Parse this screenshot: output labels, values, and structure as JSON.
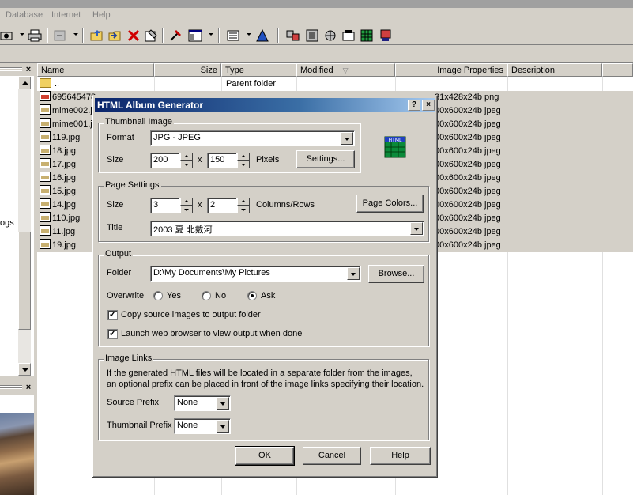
{
  "menu": {
    "database": "Database",
    "internet": "Internet",
    "help": "Help"
  },
  "icons": [
    "connect-icon",
    "printer-icon",
    "reload-icon",
    "copy-to-icon",
    "move-to-icon",
    "delete-icon",
    "properties-icon",
    "tools-icon",
    "view-icon",
    "details-view-icon",
    "filter-icon",
    "slideshow-icon",
    "edit-icon",
    "wallpaper-icon",
    "email-icon",
    "grid-icon",
    "html-icon"
  ],
  "tree": {
    "visible_text": "ogs"
  },
  "file_list": {
    "columns": {
      "name": "Name",
      "size": "Size",
      "type": "Type",
      "modified": "Modified",
      "image_properties": "Image Properties",
      "description": "Description"
    },
    "parent": {
      "name": "..",
      "type": "Parent folder"
    },
    "rows": [
      {
        "name": "695645478",
        "props": "31x428x24b png",
        "kind": "png"
      },
      {
        "name": "mime002.jp",
        "props": "00x600x24b jpeg",
        "kind": "jpg"
      },
      {
        "name": "mime001.jp",
        "props": "00x600x24b jpeg",
        "kind": "jpg"
      },
      {
        "name": "119.jpg",
        "props": "00x600x24b jpeg",
        "kind": "jpg"
      },
      {
        "name": "18.jpg",
        "props": "00x600x24b jpeg",
        "kind": "jpg"
      },
      {
        "name": "17.jpg",
        "props": "00x600x24b jpeg",
        "kind": "jpg"
      },
      {
        "name": "16.jpg",
        "props": "00x600x24b jpeg",
        "kind": "jpg"
      },
      {
        "name": "15.jpg",
        "props": "00x600x24b jpeg",
        "kind": "jpg"
      },
      {
        "name": "14.jpg",
        "props": "00x600x24b jpeg",
        "kind": "jpg"
      },
      {
        "name": "110.jpg",
        "props": "00x600x24b jpeg",
        "kind": "jpg"
      },
      {
        "name": "11.jpg",
        "props": "00x600x24b jpeg",
        "kind": "jpg"
      },
      {
        "name": "19.jpg",
        "props": "00x600x24b jpeg",
        "kind": "jpg"
      }
    ]
  },
  "dialog": {
    "title": "HTML Album Generator",
    "help_btn": "?",
    "close_btn": "×",
    "thumbnail": {
      "group": "Thumbnail Image",
      "format_label": "Format",
      "format_value": "JPG - JPEG",
      "size_label": "Size",
      "width": "200",
      "x": "x",
      "height": "150",
      "unit": "Pixels",
      "settings_btn": "Settings..."
    },
    "page": {
      "group": "Page Settings",
      "size_label": "Size",
      "columns": "3",
      "x": "x",
      "rows": "2",
      "unit": "Columns/Rows",
      "colors_btn": "Page Colors...",
      "title_label": "Title",
      "title_value": "2003 夏 北戴河"
    },
    "output": {
      "group": "Output",
      "folder_label": "Folder",
      "folder_value": "D:\\My Documents\\My Pictures",
      "browse_btn": "Browse...",
      "overwrite_label": "Overwrite",
      "yes": "Yes",
      "no": "No",
      "ask": "Ask",
      "selected": "Ask",
      "copy_label": "Copy source images to output folder",
      "copy_checked": true,
      "launch_label": "Launch web browser to view output when done",
      "launch_checked": true
    },
    "links": {
      "group": "Image Links",
      "desc_line1": "If the generated HTML files will be located in a separate folder from the images,",
      "desc_line2": "an optional prefix can be placed in front of the image links specifying their location.",
      "source_label": "Source Prefix",
      "source_value": "None",
      "thumb_label": "Thumbnail Prefix",
      "thumb_value": "None"
    },
    "ok": "OK",
    "cancel": "Cancel",
    "help": "Help"
  }
}
